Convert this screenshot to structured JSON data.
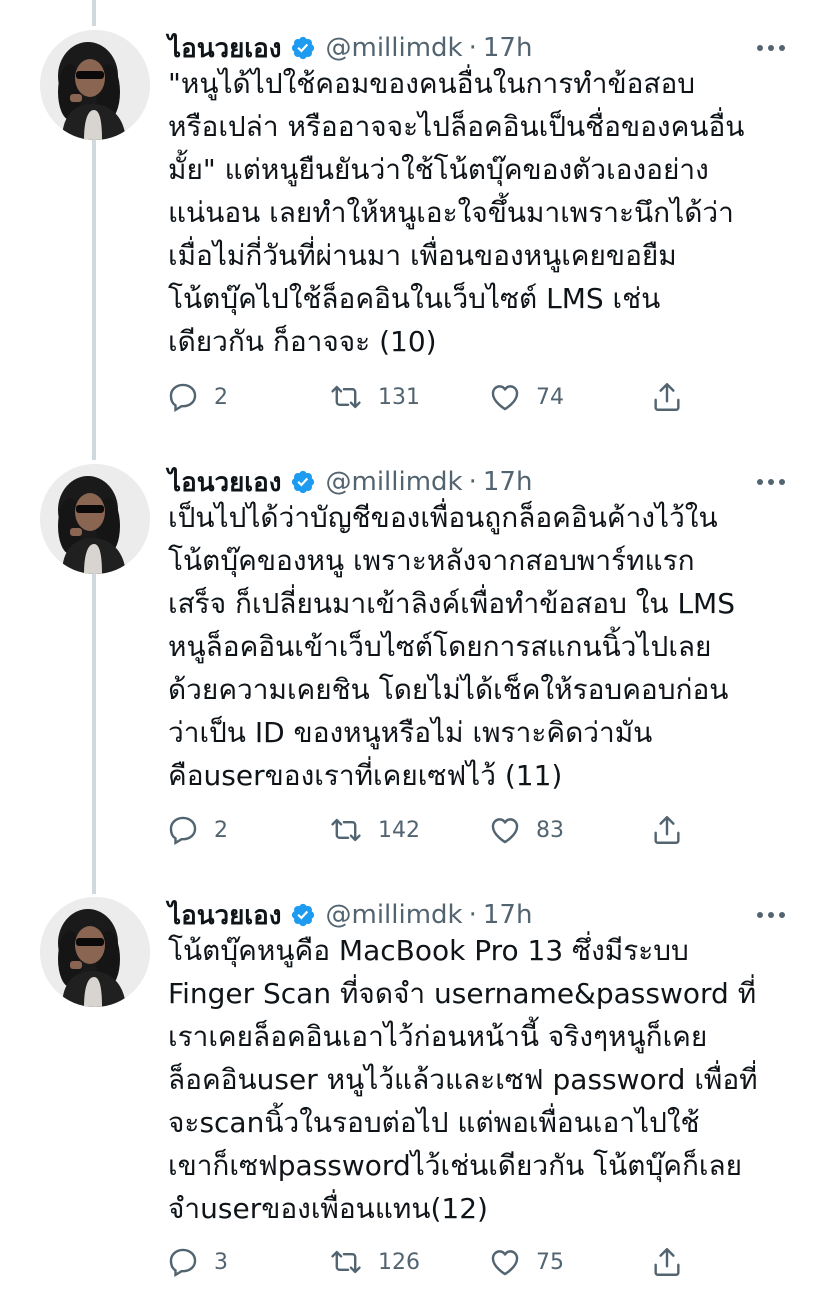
{
  "colors": {
    "text": "#0f1419",
    "muted": "#536471",
    "verified": "#1d9bf0",
    "thread_line": "#cfd9de"
  },
  "tweets": [
    {
      "author": {
        "name": "ไอนวยเอง",
        "handle": "@millimdk",
        "verified": true,
        "avatar_icon": "avatar-photo"
      },
      "separator": "·",
      "time": "17h",
      "text": "\"หนูได้ไปใช้คอมของคนอื่นในการทำข้อสอบ\nหรือเปล่า หรืออาจจะไปล็อคอินเป็นชื่อของคนอื่น\nมั้ย\" แต่หนูยืนยันว่าใช้โน้ตบุ๊คของตัวเองอย่าง\nแน่นอน เลยทำให้หนูเอะใจขึ้นมาเพราะนึกได้ว่า\nเมื่อไม่กี่วันที่ผ่านมา เพื่อนของหนูเคยขอยืม\nโน้ตบุ๊คไปใช้ล็อคอินในเว็บไซต์ LMS เช่น\nเดียวกัน ก็อาจจะ (10)",
      "replies": "2",
      "retweets": "131",
      "likes": "74"
    },
    {
      "author": {
        "name": "ไอนวยเอง",
        "handle": "@millimdk",
        "verified": true,
        "avatar_icon": "avatar-photo"
      },
      "separator": "·",
      "time": "17h",
      "text": "เป็นไปได้ว่าบัญชีของเพื่อนถูกล็อคอินค้างไว้ใน\nโน้ตบุ๊คของหนู เพราะหลังจากสอบพาร์ทแรก\nเสร็จ ก็เปลี่ยนมาเข้าลิงค์เพื่อทำข้อสอบ ใน LMS\nหนูล็อคอินเข้าเว็บไซต์โดยการสแกนนิ้วไปเลย\nด้วยความเคยชิน โดยไม่ได้เช็คให้รอบคอบก่อน\nว่าเป็น ID ของหนูหรือไม่ เพราะคิดว่ามัน\nคือuserของเราที่เคยเซฟไว้ (11)",
      "replies": "2",
      "retweets": "142",
      "likes": "83"
    },
    {
      "author": {
        "name": "ไอนวยเอง",
        "handle": "@millimdk",
        "verified": true,
        "avatar_icon": "avatar-photo"
      },
      "separator": "·",
      "time": "17h",
      "text": "โน้ตบุ๊คหนูคือ MacBook Pro 13 ซึ่งมีระบบ\nFinger Scan ที่จดจำ username&password ที่\nเราเคยล็อคอินเอาไว้ก่อนหน้านี้ จริงๆหนูก็เคย\nล็อคอินuser หนูไว้แล้วและเซฟ password เพื่อที่\nจะscanนิ้วในรอบต่อไป แต่พอเพื่อนเอาไปใช้\nเขาก็เซฟpasswordไว้เช่นเดียวกัน โน้ตบุ๊คก็เลย\nจำuserของเพื่อนแทน(12)",
      "replies": "3",
      "retweets": "126",
      "likes": "75"
    }
  ]
}
